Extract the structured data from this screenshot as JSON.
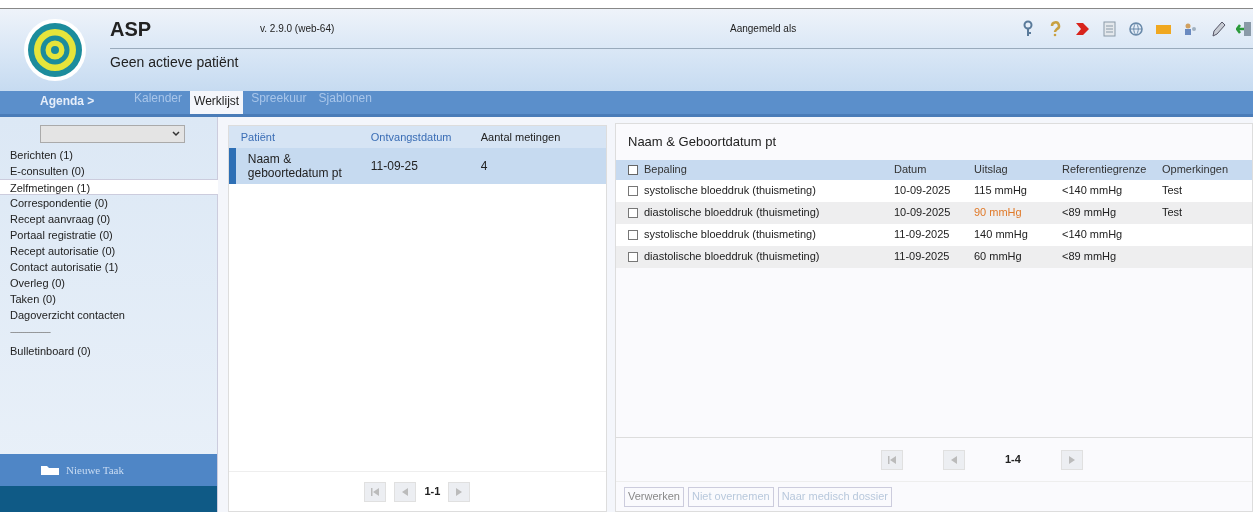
{
  "header": {
    "app_name": "ASP",
    "version": "v. 2.9.0 (web-64)",
    "patient_status": "Geen actieve patiënt",
    "login_label": "Aangemeld als"
  },
  "nav": {
    "section": "Agenda >",
    "tabs": [
      {
        "label": "Kalender",
        "selected": false
      },
      {
        "label": "Werklijst",
        "selected": true
      },
      {
        "label": "Spreekuur",
        "selected": false
      },
      {
        "label": "Sjablonen",
        "selected": false
      }
    ]
  },
  "sidebar": {
    "items": [
      {
        "kind": "item",
        "label": "Berichten (1)",
        "selected": false
      },
      {
        "kind": "item",
        "label": "E-consulten (0)",
        "selected": false
      },
      {
        "kind": "item",
        "label": "Zelfmetingen (1)",
        "selected": true
      },
      {
        "kind": "item",
        "label": "Correspondentie (0)",
        "selected": false
      },
      {
        "kind": "item",
        "label": "Recept aanvraag (0)",
        "selected": false
      },
      {
        "kind": "item",
        "label": "Portaal registratie (0)",
        "selected": false
      },
      {
        "kind": "item",
        "label": "Recept autorisatie (0)",
        "selected": false
      },
      {
        "kind": "item",
        "label": "Contact autorisatie (1)",
        "selected": false
      },
      {
        "kind": "item",
        "label": "Overleg (0)",
        "selected": false
      },
      {
        "kind": "item",
        "label": "Taken (0)",
        "selected": false
      },
      {
        "kind": "item",
        "label": "Dagoverzicht contacten",
        "selected": false
      },
      {
        "kind": "separator",
        "label": "--------------------"
      },
      {
        "kind": "item",
        "label": "Bulletinboard (0)",
        "selected": false
      }
    ],
    "new_task": "Nieuwe Taak"
  },
  "worklist": {
    "columns": [
      "Patiënt",
      "Ontvangstdatum",
      "Aantal metingen"
    ],
    "rows": [
      {
        "selected": true,
        "cells": [
          "Naam & geboortedatum pt",
          "11-09-25",
          "4"
        ]
      }
    ],
    "pager": "1-1"
  },
  "detail": {
    "title": "Naam & Geboortdatum pt",
    "select_all_checked": false,
    "columns": [
      "Bepaling",
      "Datum",
      "Uitslag",
      "Referentiegrenze",
      "Opmerkingen"
    ],
    "rows": [
      {
        "checked": false,
        "abnormal": false,
        "cells": [
          "systolische bloeddruk (thuismeting)",
          "10-09-2025",
          "115 mmHg",
          "<140 mmHg",
          "Test"
        ]
      },
      {
        "checked": false,
        "abnormal": true,
        "cells": [
          "diastolische bloeddruk (thuismeting)",
          "10-09-2025",
          "90 mmHg",
          "<89 mmHg",
          "Test"
        ]
      },
      {
        "checked": false,
        "abnormal": false,
        "cells": [
          "systolische bloeddruk (thuismeting)",
          "11-09-2025",
          "140 mmHg",
          "<140 mmHg"
        ]
      },
      {
        "checked": false,
        "abnormal": false,
        "cells": [
          "diastolische bloeddruk (thuismeting)",
          "11-09-2025",
          "60 mmHg",
          "<89 mmHg"
        ]
      }
    ],
    "pager": "1-4",
    "actions": [
      "Verwerken",
      "Niet overnemen",
      "Naar medisch dossier"
    ]
  }
}
